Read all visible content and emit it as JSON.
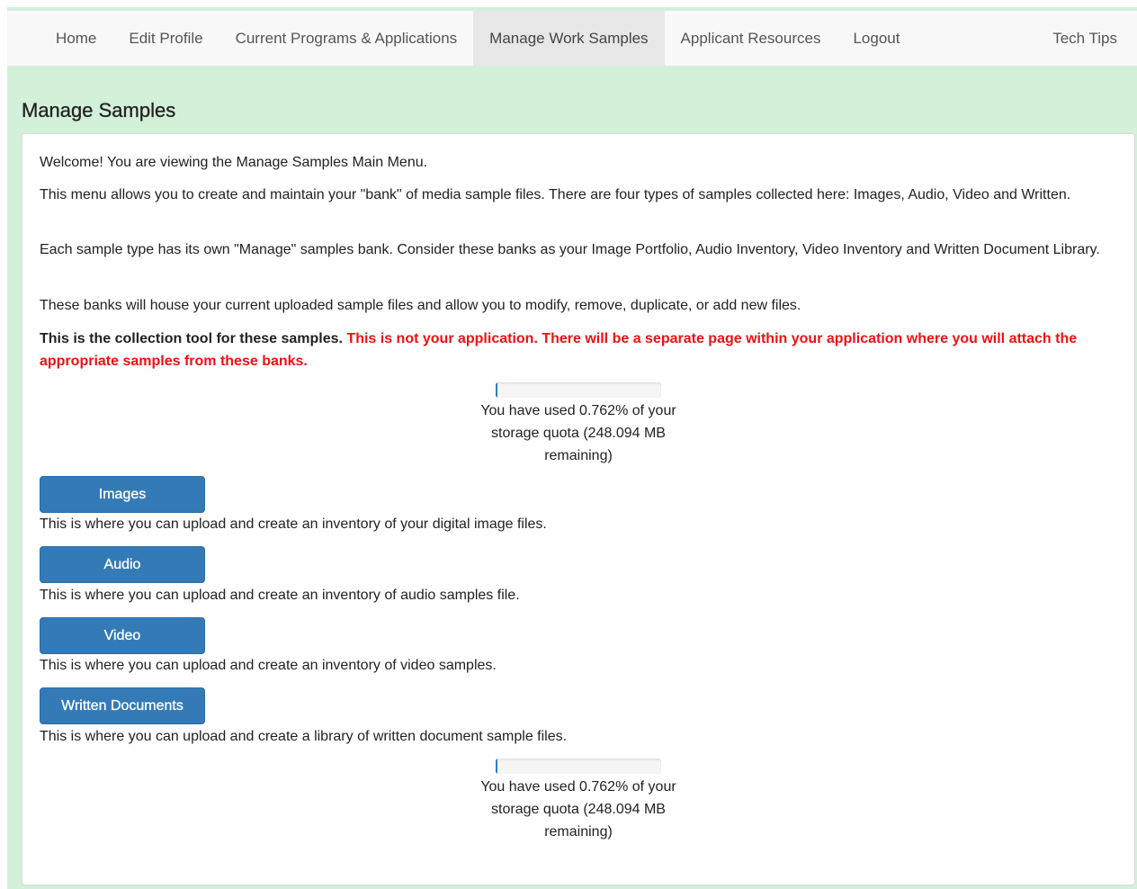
{
  "nav": {
    "items": [
      {
        "label": "Home",
        "name": "nav-home"
      },
      {
        "label": "Edit Profile",
        "name": "nav-edit-profile"
      },
      {
        "label": "Current Programs & Applications",
        "name": "nav-current-programs"
      },
      {
        "label": "Manage Work Samples",
        "name": "nav-manage-work-samples",
        "active": true
      },
      {
        "label": "Applicant Resources",
        "name": "nav-applicant-resources"
      },
      {
        "label": "Logout",
        "name": "nav-logout"
      }
    ],
    "right_item": "Tech Tips"
  },
  "page": {
    "title": "Manage Samples"
  },
  "intro": {
    "welcome": "Welcome! You are viewing the Manage Samples Main Menu.",
    "menu_desc": "This menu allows you to create and maintain your \"bank\" of media sample files. There are four types of samples collected here: Images, Audio, Video and Written.",
    "banks_desc": "Each sample type has its own \"Manage\" samples bank. Consider these banks as your Image Portfolio, Audio Inventory, Video Inventory and Written Document Library.",
    "house_desc": "These banks will house your current uploaded sample files and allow you to modify, remove, duplicate, or add new files.",
    "notice_bold": "This is the collection tool for these samples.",
    "notice_red": "This is not your application. There will be a separate page within your application where you will attach the appropriate samples from these banks."
  },
  "quota": {
    "percent_used": 0.762,
    "text": "You have used 0.762% of your storage quota (248.094 MB remaining)"
  },
  "samples": [
    {
      "button": "Images",
      "description": "This is where you can upload and create an inventory of your digital image files."
    },
    {
      "button": "Audio",
      "description": "This is where you can upload and create an inventory of audio samples file."
    },
    {
      "button": "Video",
      "description": "This is where you can upload and create an inventory of video samples."
    },
    {
      "button": "Written Documents",
      "description": "This is where you can upload and create a library of written document sample files."
    }
  ],
  "colors": {
    "page_background": "#d3f0d9",
    "primary_button": "#337ab7",
    "warning_text": "#ee1111"
  }
}
